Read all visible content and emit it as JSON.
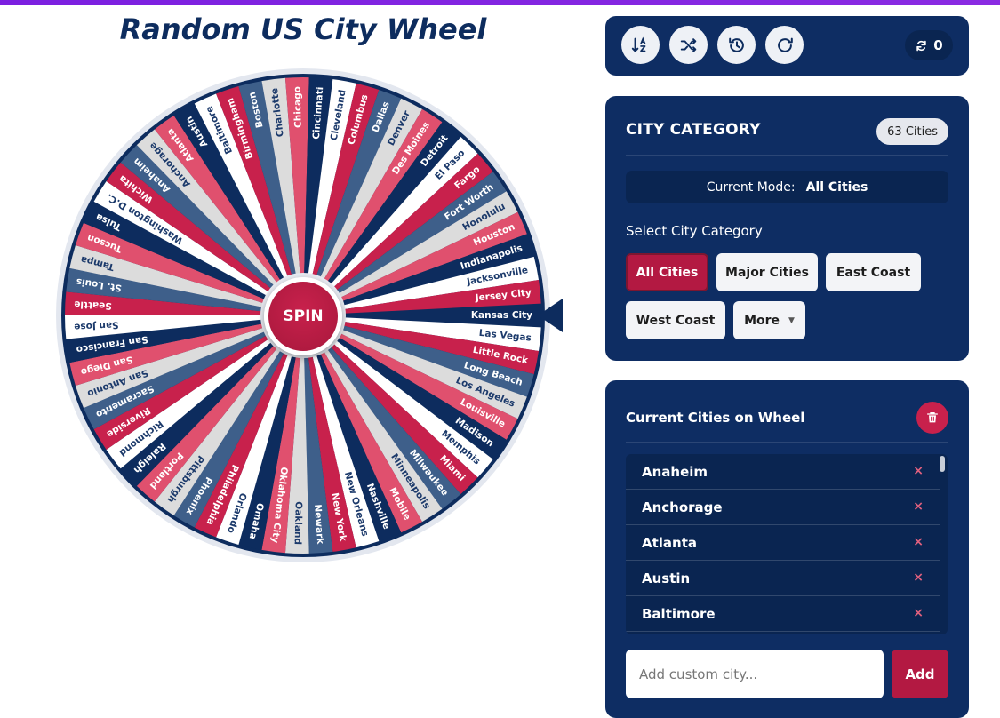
{
  "page": {
    "title": "Random US City Wheel"
  },
  "wheel": {
    "spin_label": "SPIN",
    "colors": [
      "#0d2c5e",
      "#ffffff",
      "#c8214c",
      "#3e5f8a",
      "#dcdcdc",
      "#e0506e"
    ],
    "rim_color": "#0d2c5e",
    "cities": [
      "Kansas City",
      "Las Vegas",
      "Little Rock",
      "Long Beach",
      "Los Angeles",
      "Louisville",
      "Madison",
      "Memphis",
      "Miami",
      "Milwaukee",
      "Minneapolis",
      "Mobile",
      "Nashville",
      "New Orleans",
      "New York",
      "Newark",
      "Oakland",
      "Oklahoma City",
      "Omaha",
      "Orlando",
      "Philadelphia",
      "Phoenix",
      "Pittsburgh",
      "Portland",
      "Raleigh",
      "Richmond",
      "Riverside",
      "Sacramento",
      "San Antonio",
      "San Diego",
      "San Francisco",
      "San Jose",
      "Seattle",
      "St. Louis",
      "Tampa",
      "Tucson",
      "Tulsa",
      "Washington D.C.",
      "Wichita",
      "Anaheim",
      "Anchorage",
      "Atlanta",
      "Austin",
      "Baltimore",
      "Birmingham",
      "Boston",
      "Charlotte",
      "Chicago",
      "Cincinnati",
      "Cleveland",
      "Columbus",
      "Dallas",
      "Denver",
      "Des Moines",
      "Detroit",
      "El Paso",
      "Fargo",
      "Fort Worth",
      "Honolulu",
      "Houston",
      "Indianapolis",
      "Jacksonville",
      "Jersey City"
    ]
  },
  "toolbar": {
    "buttons": [
      {
        "name": "sort-button",
        "icon": "sort-az-icon"
      },
      {
        "name": "shuffle-button",
        "icon": "shuffle-icon"
      },
      {
        "name": "history-button",
        "icon": "history-icon"
      },
      {
        "name": "reset-button",
        "icon": "redo-icon"
      }
    ],
    "spin_count": "0"
  },
  "category": {
    "title": "CITY CATEGORY",
    "count_badge": "63 Cities",
    "mode_label": "Current Mode:",
    "mode_value": "All Cities",
    "select_label": "Select City Category",
    "buttons": [
      "All Cities",
      "Major Cities",
      "East Coast",
      "West Coast",
      "More"
    ]
  },
  "current": {
    "title": "Current Cities on Wheel",
    "list": [
      "Anaheim",
      "Anchorage",
      "Atlanta",
      "Austin",
      "Baltimore"
    ],
    "remove_glyph": "×",
    "input_placeholder": "Add custom city...",
    "add_label": "Add"
  }
}
